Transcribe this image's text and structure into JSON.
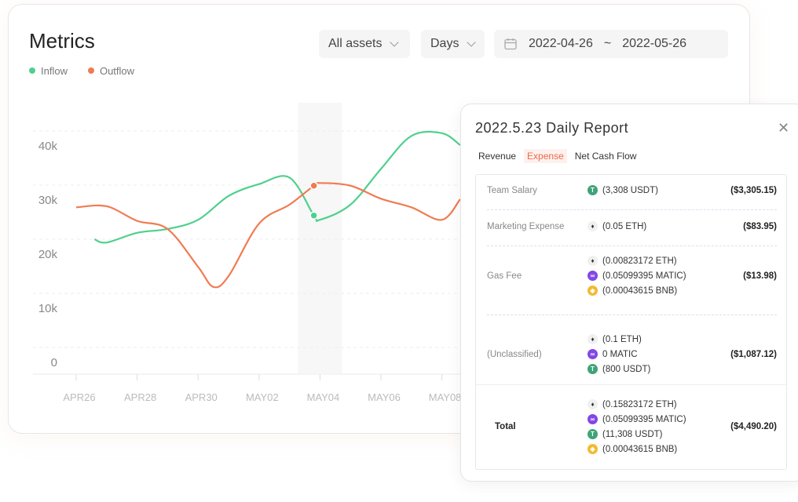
{
  "header": {
    "title": "Metrics",
    "asset_filter": "All assets",
    "period": "Days",
    "date_from": "2022-04-26",
    "date_sep": "~",
    "date_to": "2022-05-26"
  },
  "legend": [
    {
      "label": "Inflow",
      "color": "#4fd08d"
    },
    {
      "label": "Outflow",
      "color": "#f07b52"
    }
  ],
  "chart_data": {
    "type": "line",
    "x_ticks": [
      "APR26",
      "APR28",
      "APR30",
      "MAY02",
      "MAY04",
      "MAY06",
      "MAY08"
    ],
    "y_ticks": [
      "0",
      "10k",
      "20k",
      "30k",
      "40k"
    ],
    "ylim": [
      0,
      42000
    ],
    "highlight": "MAY04",
    "series": [
      {
        "name": "Inflow",
        "color": "#4fd08d",
        "points": [
          [
            0.6,
            22600
          ],
          [
            1,
            22000
          ],
          [
            2,
            23800
          ],
          [
            3,
            24500
          ],
          [
            4,
            26200
          ],
          [
            5,
            30600
          ],
          [
            6,
            32800
          ],
          [
            7,
            34000
          ],
          [
            7.8,
            27000
          ],
          [
            8,
            26200
          ],
          [
            9,
            29000
          ],
          [
            10,
            35600
          ],
          [
            11,
            41700
          ],
          [
            12,
            42200
          ],
          [
            12.6,
            40000
          ]
        ]
      },
      {
        "name": "Outflow",
        "color": "#f07b52",
        "points": [
          [
            0,
            28500
          ],
          [
            1,
            28700
          ],
          [
            2,
            26000
          ],
          [
            3,
            24500
          ],
          [
            4,
            17500
          ],
          [
            4.5,
            13800
          ],
          [
            5,
            15800
          ],
          [
            6,
            25500
          ],
          [
            7,
            29000
          ],
          [
            7.8,
            32500
          ],
          [
            8,
            33000
          ],
          [
            9,
            32500
          ],
          [
            10,
            30100
          ],
          [
            11,
            28500
          ],
          [
            12,
            26200
          ],
          [
            12.6,
            30000
          ]
        ]
      }
    ]
  },
  "report": {
    "title": "2022.5.23 Daily Report",
    "tabs": [
      "Revenue",
      "Expense",
      "Net Cash Flow"
    ],
    "active_tab": "Expense",
    "rows": [
      {
        "label": "Team Salary",
        "assets": [
          {
            "icon": "usdt-icon",
            "text": "(3,308 USDT)"
          }
        ],
        "amount": "($3,305.15)"
      },
      {
        "label": "Marketing Expense",
        "assets": [
          {
            "icon": "eth-icon",
            "text": "(0.05 ETH)"
          }
        ],
        "amount": "($83.95)"
      },
      {
        "label": "Gas Fee",
        "assets": [
          {
            "icon": "eth-icon",
            "text": "(0.00823172 ETH)"
          },
          {
            "icon": "matic-icon",
            "text": "(0.05099395 MATIC)"
          },
          {
            "icon": "bnb-icon",
            "text": "(0.00043615 BNB)"
          }
        ],
        "amount": "($13.98)"
      },
      {
        "label": "(Unclassified)",
        "assets": [
          {
            "icon": "eth-icon",
            "text": "(0.1 ETH)"
          },
          {
            "icon": "matic-icon",
            "text": "0 MATIC"
          },
          {
            "icon": "usdt-icon",
            "text": "(800 USDT)"
          }
        ],
        "amount": "($1,087.12)"
      },
      {
        "label": "Total",
        "assets": [
          {
            "icon": "eth-icon",
            "text": "(0.15823172 ETH)"
          },
          {
            "icon": "matic-icon",
            "text": "(0.05099395 MATIC)"
          },
          {
            "icon": "usdt-icon",
            "text": "(11,308 USDT)"
          },
          {
            "icon": "bnb-icon",
            "text": "(0.00043615 BNB)"
          }
        ],
        "amount": "($4,490.20)"
      }
    ]
  }
}
